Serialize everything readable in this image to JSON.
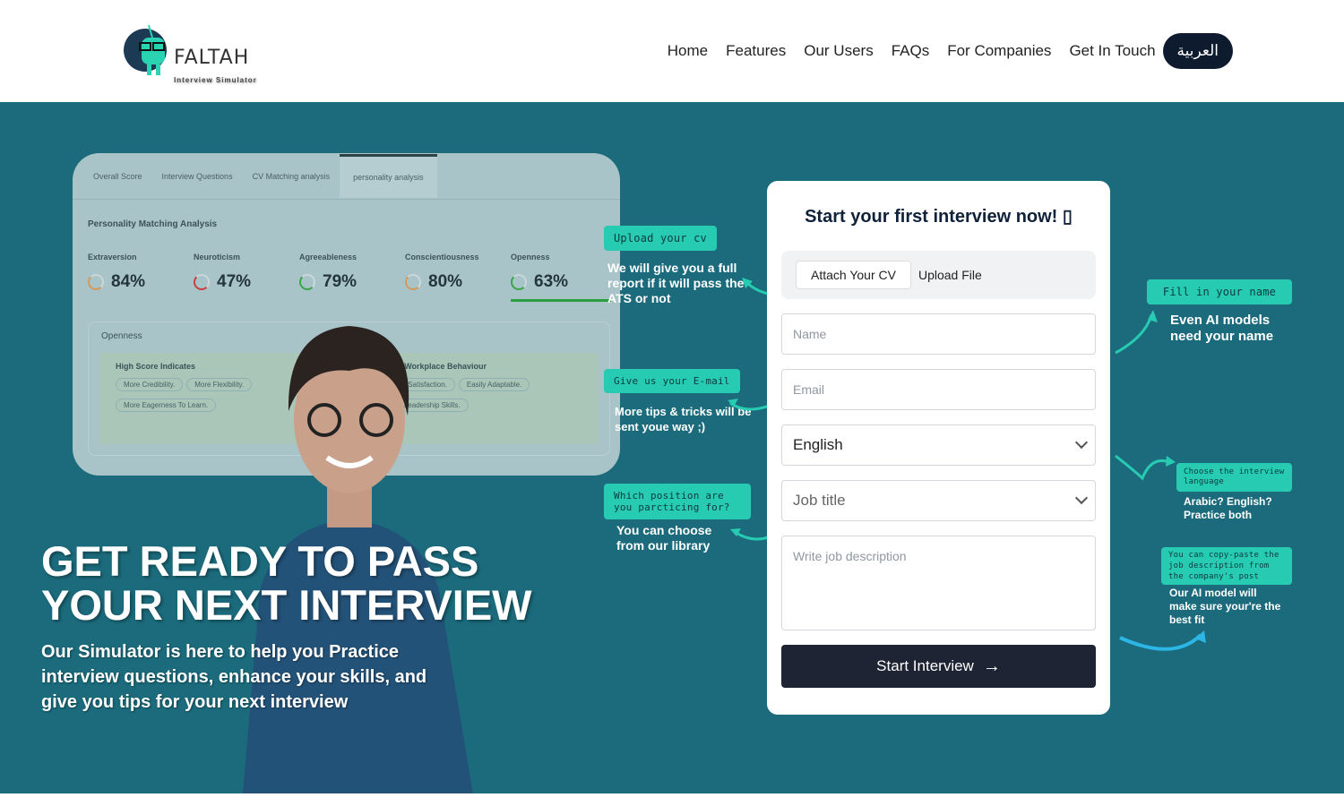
{
  "nav": {
    "logo_word": "FALTAH",
    "logo_sub": "Interview Simulator",
    "items": [
      "Home",
      "Features",
      "Our Users",
      "FAQs",
      "For Companies",
      "Get In Touch"
    ],
    "lang": "العربية"
  },
  "shot": {
    "tabs": [
      "Overall Score",
      "Interview Questions",
      "CV Matching analysis",
      "personality analysis"
    ],
    "heading": "Personality Matching Analysis",
    "metrics": [
      {
        "label": "Extraversion",
        "value": "84%",
        "color": "#d49a5c"
      },
      {
        "label": "Neuroticism",
        "value": "47%",
        "color": "#c9403f"
      },
      {
        "label": "Agreeableness",
        "value": "79%",
        "color": "#3aa54a"
      },
      {
        "label": "Conscientiousness",
        "value": "80%",
        "color": "#d49a5c"
      },
      {
        "label": "Openness",
        "value": "63%",
        "color": "#3aa54a"
      }
    ],
    "section": "Openness",
    "high": "High Score Indicates",
    "workplace": "ted Workplace Behaviour",
    "chips1": [
      "More Credibility.",
      "More Flexibility.",
      "More Eagerness To Learn."
    ],
    "chips2": [
      "ob Satisfaction.",
      "Easily Adaptable.",
      "g Leadership Skills."
    ]
  },
  "hero": {
    "title1": "GET READY TO PASS",
    "title2": "YOUR NEXT INTERVIEW",
    "subtitle": "Our Simulator is here to help you Practice interview questions, enhance your skills, and give you tips for your next interview"
  },
  "tips": {
    "cv_tag": "Upload your cv",
    "cv_note": "We will give you a full report if it will pass the ATS or not",
    "email_tag": "Give us your E-mail",
    "email_note": "More tips & tricks will be sent youe way ;)",
    "job_tag": "Which position are you parcticing for?",
    "job_note": "You can choose from our library",
    "name_tag": "Fill in your name",
    "name_note": "Even AI models need your name",
    "lang_tag": "Choose the interview language",
    "lang_note": "Arabic? English? Practice both",
    "desc_tag": "You can copy-paste the job description from the company's post",
    "desc_note": "Our AI model will make sure your're the best fit"
  },
  "form": {
    "title": "Start your first interview now! ▯",
    "attach": "Attach Your CV",
    "upload": "Upload File",
    "name_ph": "Name",
    "email_ph": "Email",
    "language": "English",
    "job": "Job title",
    "desc_ph": "Write job description",
    "start": "Start Interview"
  },
  "colors": {
    "hero_bg": "#1b6b7c",
    "accent": "#27cbb1",
    "nav_dark": "#0e1b2e",
    "button": "#1e2433"
  }
}
